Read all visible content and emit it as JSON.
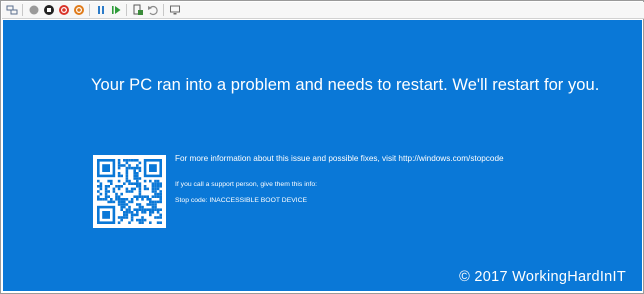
{
  "toolbar": {
    "buttons": [
      {
        "icon": "ctrl-alt-del-icon",
        "color": "#5a6e8c"
      },
      {
        "icon": "start-icon",
        "color": "#8a8a8a"
      },
      {
        "icon": "turn-off-icon",
        "color": "#222222"
      },
      {
        "icon": "shut-down-icon",
        "color": "#d9342b"
      },
      {
        "icon": "save-icon",
        "color": "#e07b1a"
      },
      {
        "icon": "pause-icon",
        "color": "#2b7bc9"
      },
      {
        "icon": "resume-icon",
        "color": "#2e9c3a"
      },
      {
        "icon": "checkpoint-icon",
        "color": "#3a8a3a"
      },
      {
        "icon": "revert-icon",
        "color": "#8a8a8a"
      },
      {
        "icon": "enhanced-session-icon",
        "color": "#6a6a6a"
      }
    ]
  },
  "bsod": {
    "background": "#0a78d7",
    "headline": "Your PC ran into a problem and needs to restart. We'll restart for you.",
    "info": "For more information about this issue and possible fixes, visit http://windows.com/stopcode",
    "support": "If you call a support person, give them this info:",
    "stop_code": "Stop code: INACCESSIBLE BOOT DEVICE"
  },
  "watermark": "© 2017 WorkingHardInIT"
}
